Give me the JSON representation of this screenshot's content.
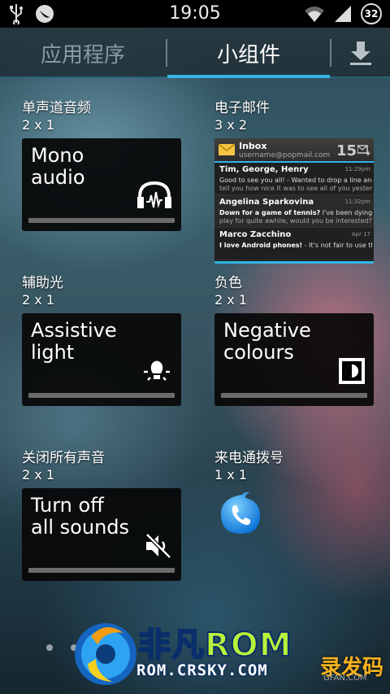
{
  "status_bar": {
    "time": "19:05",
    "battery": "32",
    "left_icons": [
      "usb-icon",
      "debug-icon"
    ],
    "right_icons": [
      "wifi-icon",
      "signal-icon",
      "battery-icon"
    ]
  },
  "tabs": {
    "apps": "应用程序",
    "widgets": "小组件",
    "active": "widgets",
    "store_icon": "download-icon",
    "accent": "#33b5e5"
  },
  "widgets": [
    {
      "label": "单声道音频",
      "size": "2 x 1",
      "title_line1": "Mono",
      "title_line2": "audio",
      "icon": "headphones-icon"
    },
    {
      "label": "电子邮件",
      "size": "3 x 2"
    },
    {
      "label": "辅助光",
      "size": "2 x 1",
      "title_line1": "Assistive",
      "title_line2": "light",
      "icon": "bulb-icon"
    },
    {
      "label": "负色",
      "size": "2 x 1",
      "title_line1": "Negative",
      "title_line2": "colours",
      "icon": "invert-icon"
    },
    {
      "label": "关闭所有声音",
      "size": "2 x 1",
      "title_line1": "Turn off",
      "title_line2": "all sounds",
      "icon": "mute-icon"
    },
    {
      "label": "来电通拨号",
      "size": "1 x 1",
      "icon": "phone-icon"
    }
  ],
  "email": {
    "inbox": "Inbox",
    "account": "username@popmail.com",
    "count": "15",
    "messages": [
      {
        "from": "Tim, George, Henry",
        "time": "11:29pm",
        "line1": "Good to see you all! - Wanted to drop a line and",
        "line2": "tell you how nice it was to see all of you yesterd..."
      },
      {
        "from": "Angelina Sparkovina",
        "time": "11:32pm",
        "line1_bold": "Down for a game of tennis?",
        "line1": " I've been dying to",
        "line2": "play for quite awhile, would you be interested?"
      },
      {
        "from": "Marco Zacchino",
        "time": "Apr 17",
        "line1_bold": "I love Android phones!",
        "line1": " - It's not fair to use the",
        "line2": ""
      }
    ]
  },
  "watermark": {
    "brand": "非凡ROM",
    "url": "ROM.CRSKY.COM",
    "brand2": "录发码",
    "brand2_sub": "GFAN.COM"
  }
}
